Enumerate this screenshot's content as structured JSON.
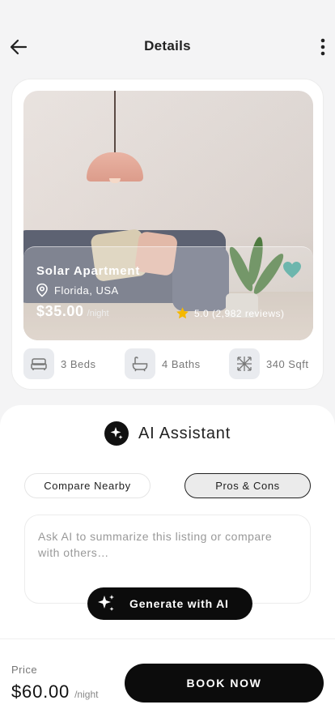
{
  "header": {
    "title": "Details"
  },
  "listing": {
    "name": "Solar Apartment",
    "location": "Florida, USA",
    "price": "$35.00",
    "price_unit": "/night",
    "rating": "5.0 (2,982 reviews)",
    "favorite": true,
    "amenities": [
      {
        "icon": "bed-icon",
        "label": "3 Beds"
      },
      {
        "icon": "bathtub-icon",
        "label": "4 Baths"
      },
      {
        "icon": "area-icon",
        "label": "340 Sqft"
      }
    ]
  },
  "ai": {
    "title": "AI Assistant",
    "tabs": [
      {
        "label": "Compare Nearby",
        "active": false
      },
      {
        "label": "Pros & Cons",
        "active": true
      }
    ],
    "placeholder": "Ask AI to summarize this listing or compare with others…",
    "generate_label": "Generate with AI"
  },
  "footer": {
    "price_label": "Price",
    "price": "$60.00",
    "price_unit": "/night",
    "book_label": "BOOK NOW"
  },
  "colors": {
    "accent_dark": "#0c0c0c",
    "heart": "#6db6ad",
    "star": "#f5b800",
    "background": "#f4f4f5"
  }
}
